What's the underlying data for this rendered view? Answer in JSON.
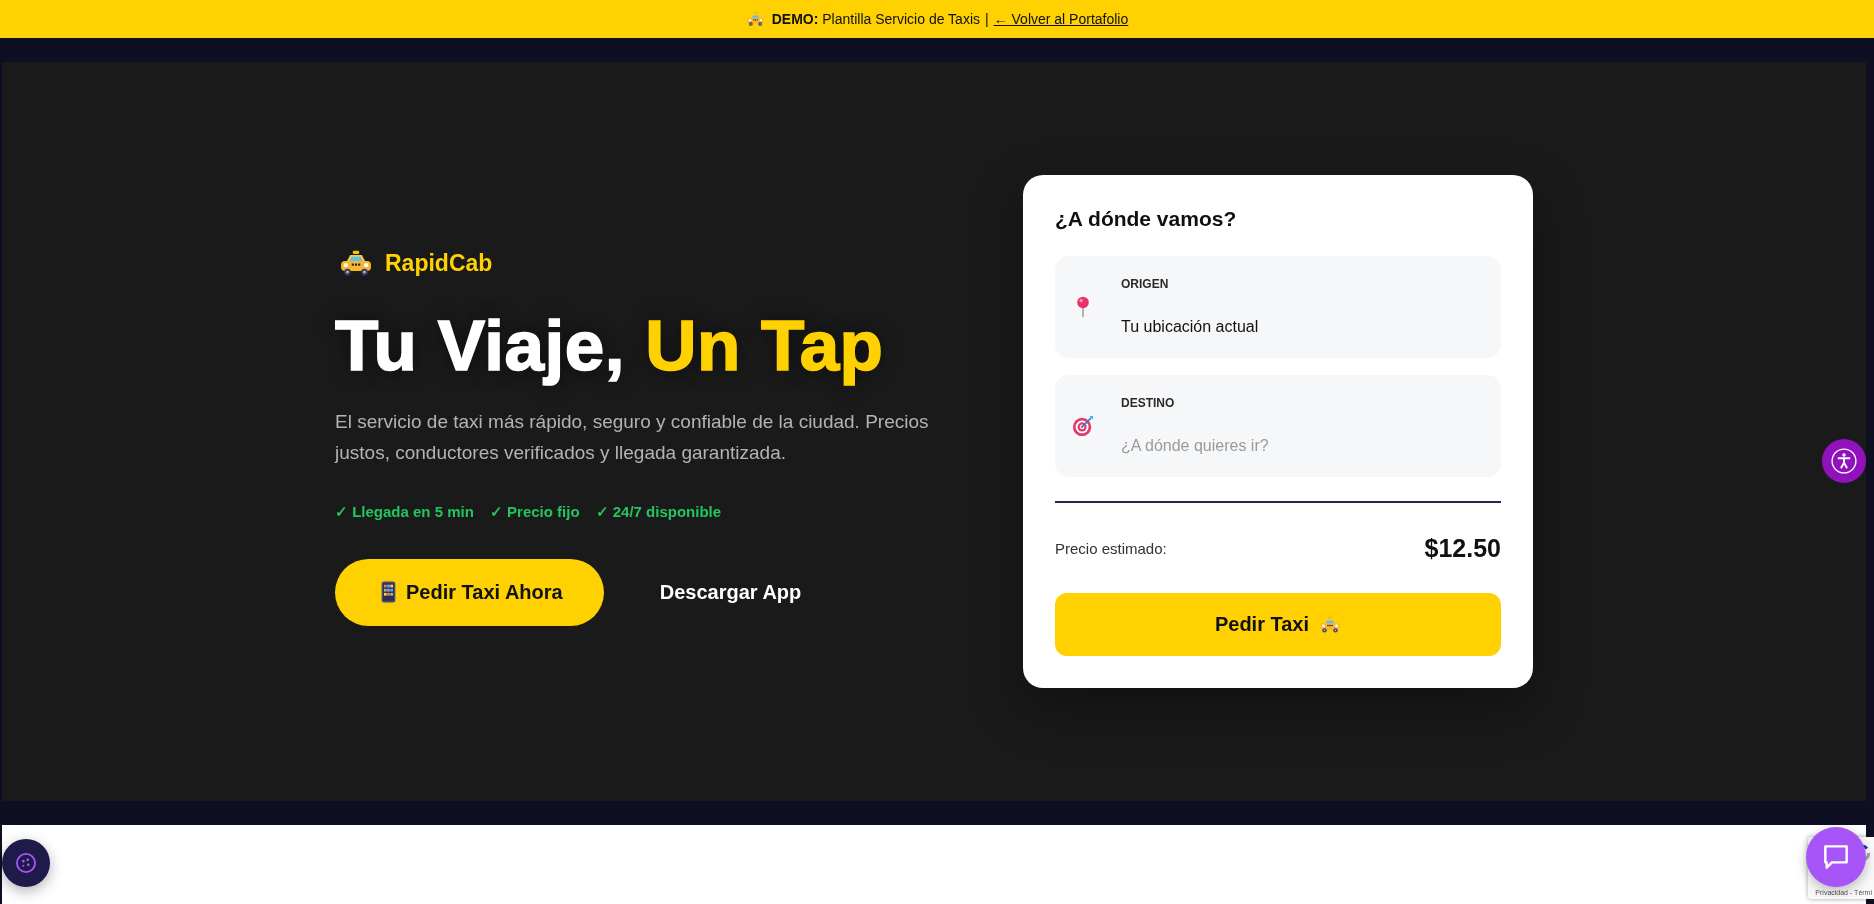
{
  "banner": {
    "text": "**DEMO:** Plantilla Servicio de Taxis",
    "separator": "|",
    "link": "← Volver al Portafolio"
  },
  "hero": {
    "brand": "RapidCab",
    "title": "Tu Viaje,",
    "title_accent": "Un Tap",
    "description": "El servicio de taxi más rápido, seguro y confiable de la ciudad. Precios justos, conductores verificados y llegada garantizada.",
    "features": [
      "✓ Llegada en 5 min",
      "✓ Precio fijo",
      "✓ 24/7 disponible"
    ],
    "buttons": [
      {
        "label": "Pedir Taxi Ahora",
        "kind": "primary"
      },
      {
        "label": "Descargar App",
        "kind": "secondary"
      }
    ]
  },
  "booking": {
    "title": "¿A dónde vamos?",
    "fields": [
      {
        "kind": "origin",
        "label": "ORIGEN",
        "value": "Tu ubicación actual"
      },
      {
        "kind": "destination",
        "label": "DESTINO",
        "placeholder": "¿A dónde quieres ir?"
      }
    ],
    "price_label": "Precio estimado:",
    "price": "$12.50",
    "submit": "Pedir Taxi"
  },
  "privacy_badge": {
    "text": "Privacidad - Térmi"
  }
}
